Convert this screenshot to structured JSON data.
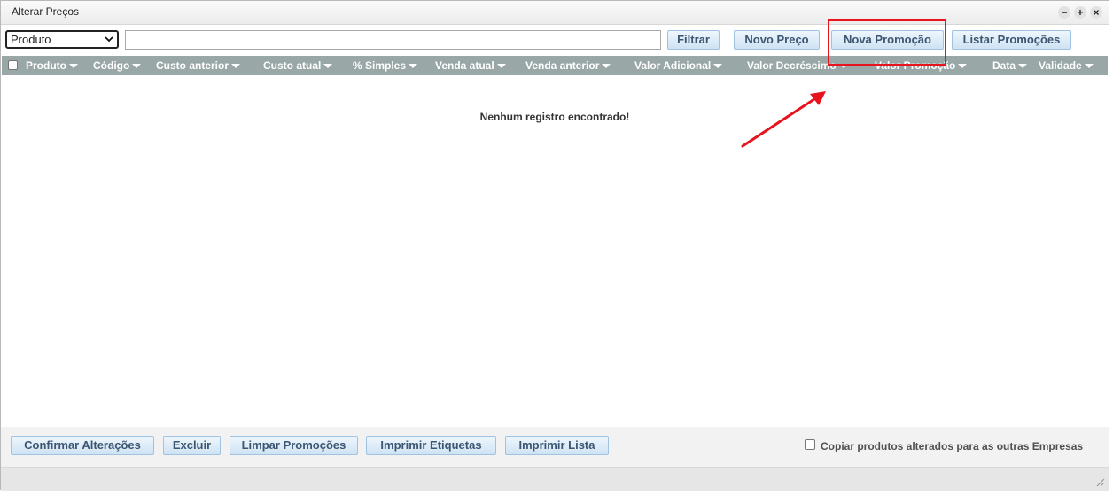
{
  "window": {
    "title": "Alterar Preços",
    "controls": [
      "−",
      "+",
      "×"
    ]
  },
  "toolbar": {
    "select_value": "Produto",
    "search_value": "",
    "filter_label": "Filtrar",
    "new_price_label": "Novo Preço",
    "new_promo_label": "Nova Promoção",
    "list_promos_label": "Listar Promoções"
  },
  "table": {
    "columns": [
      "Produto",
      "Código",
      "Custo anterior",
      "Custo atual",
      "% Simples",
      "Venda atual",
      "Venda anterior",
      "Valor Adicional",
      "Valor Decréscimo",
      "Valor Promoção",
      "Data",
      "Validade"
    ],
    "empty_message": "Nenhum registro encontrado!"
  },
  "footer": {
    "confirm_label": "Confirmar Alterações",
    "delete_label": "Excluir",
    "clear_promos_label": "Limpar Promoções",
    "print_labels_label": "Imprimir Etiquetas",
    "print_list_label": "Imprimir Lista",
    "copy_label": "Copiar produtos alterados para as outras Empresas"
  },
  "annotation": {
    "color": "#e8141d"
  },
  "colors": {
    "header_bg": "#9aa7a7",
    "button_text": "#3c5670",
    "button_border": "#9fc3e0"
  }
}
